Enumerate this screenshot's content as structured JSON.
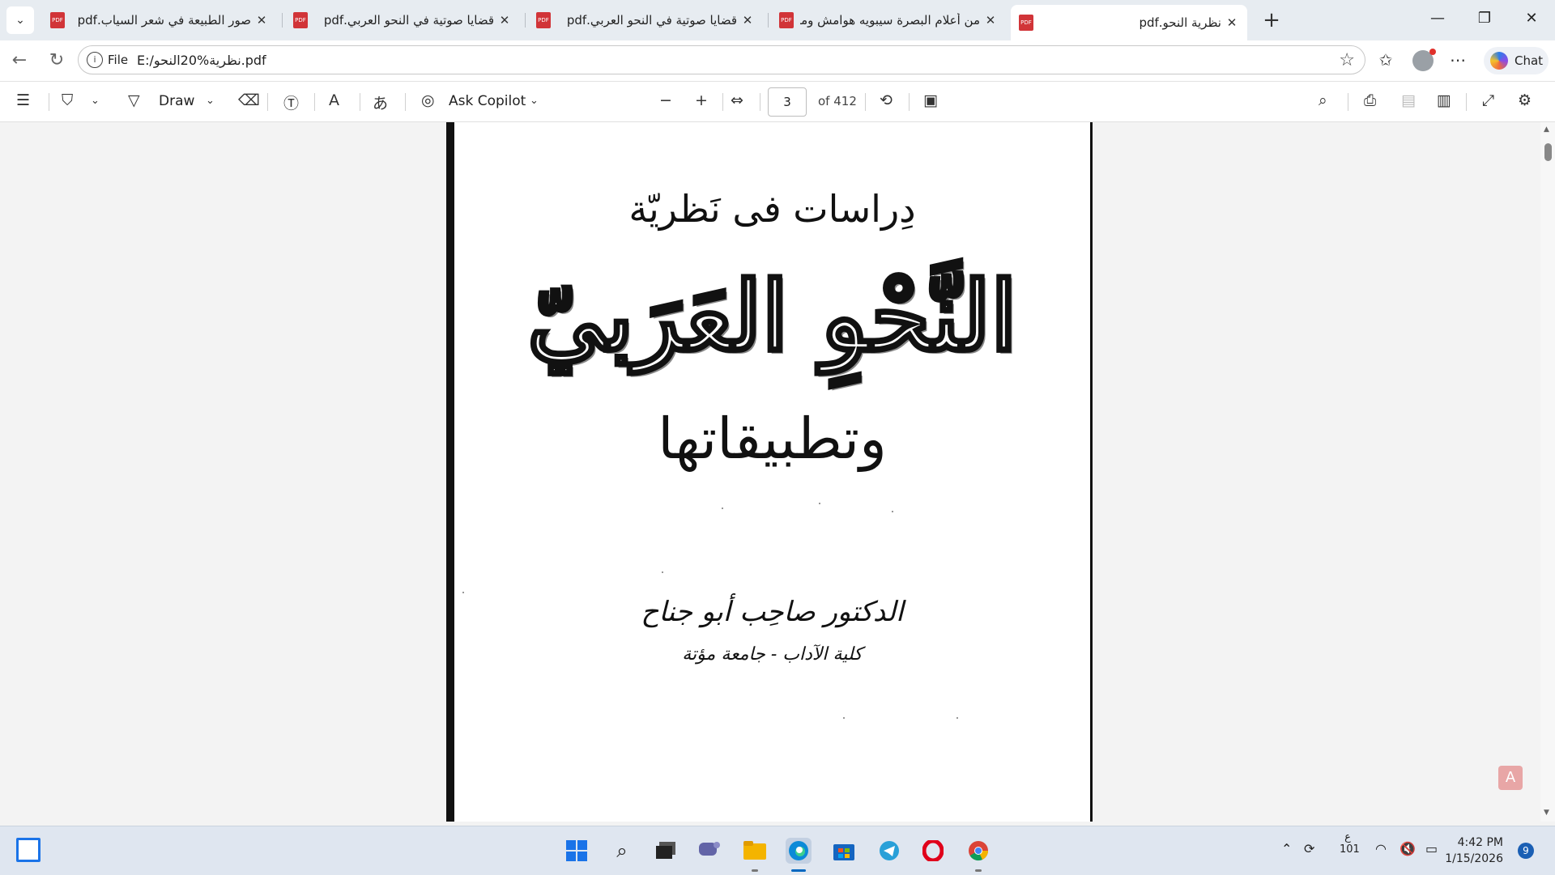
{
  "tabs": [
    {
      "title": "صور الطبيعة في شعر السياب.pdf",
      "active": false
    },
    {
      "title": "قضايا صوتية في النحو العربي.pdf",
      "active": false
    },
    {
      "title": "قضايا صوتية في النحو العربي.pdf",
      "active": false
    },
    {
      "title": "من أعلام البصرة سيبويه هوامش وملا",
      "active": false
    },
    {
      "title": "نظرية النحو.pdf",
      "active": true
    }
  ],
  "address": {
    "scheme_label": "File",
    "url": "E:/نظرية%20النحو.pdf"
  },
  "chat_label": "Chat",
  "pdf_toolbar": {
    "draw_label": "Draw",
    "ask_copilot_label": "Ask Copilot",
    "page_number": "3",
    "page_total": "of 412"
  },
  "document": {
    "line1": "دِراسات فى نَظريّة",
    "line2": "النَّحْوِ العَرَبيّ",
    "line3": "وتطبيقاتها",
    "author": "الدكتور صاحِب أبو جناح",
    "affiliation": "كلية الآداب - جامعة مؤتة"
  },
  "taskbar": {
    "tray_lang": "ع",
    "tray_number": "101",
    "time": "4:42 PM",
    "date": "1/15/2026",
    "notification_count": "9"
  },
  "colors": {
    "accent": "#0067c0",
    "pdf_icon": "#d13438",
    "taskbar": "#dfe6f0"
  }
}
